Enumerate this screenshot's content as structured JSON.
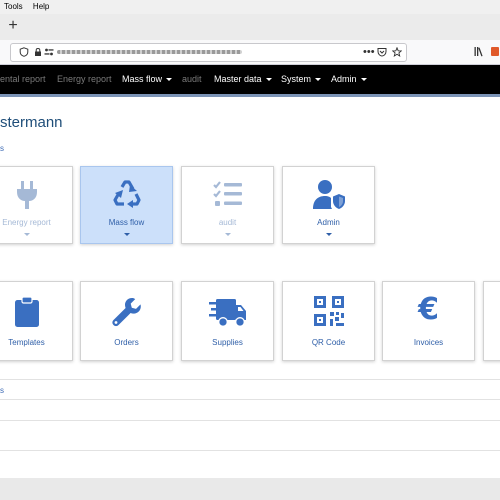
{
  "browser": {
    "menu": [
      "Tools",
      "Help"
    ],
    "new_tab_symbol": "+",
    "overflow_symbol": "•••"
  },
  "navbar": {
    "items": [
      {
        "label": "ental report",
        "style": "muted",
        "has_caret": false
      },
      {
        "label": "Energy report",
        "style": "muted",
        "has_caret": false
      },
      {
        "label": "Mass flow",
        "style": "active",
        "has_caret": true
      },
      {
        "label": "audit",
        "style": "muted",
        "has_caret": false
      },
      {
        "label": "Master data",
        "style": "active",
        "has_caret": true
      },
      {
        "label": "System",
        "style": "active",
        "has_caret": true
      },
      {
        "label": "Admin",
        "style": "active",
        "has_caret": true
      }
    ],
    "background": "#000000",
    "accent_line": "#7b93b6"
  },
  "page": {
    "title": "stermann",
    "title_color": "#1f4e79",
    "section_label": "s",
    "list_label": "s"
  },
  "modules_row": [
    {
      "label": "Energy report",
      "icon": "plug-icon",
      "state": "disabled"
    },
    {
      "label": "Mass flow",
      "icon": "recycle-icon",
      "state": "selected"
    },
    {
      "label": "audit",
      "icon": "checklist-icon",
      "state": "disabled"
    },
    {
      "label": "Admin",
      "icon": "user-shield-icon",
      "state": "normal"
    }
  ],
  "shortcuts_row": [
    {
      "label": "Templates",
      "icon": "clipboard-icon"
    },
    {
      "label": "Orders",
      "icon": "wrench-icon"
    },
    {
      "label": "Supplies",
      "icon": "truck-icon"
    },
    {
      "label": "QR Code",
      "icon": "qr-code-icon"
    },
    {
      "label": "Invoices",
      "icon": "euro-icon",
      "symbol": "€"
    }
  ],
  "colors": {
    "icon_blue": "#3a6fc1",
    "icon_dim": "#a5b9d6",
    "selected_bg": "#cce0fa"
  }
}
